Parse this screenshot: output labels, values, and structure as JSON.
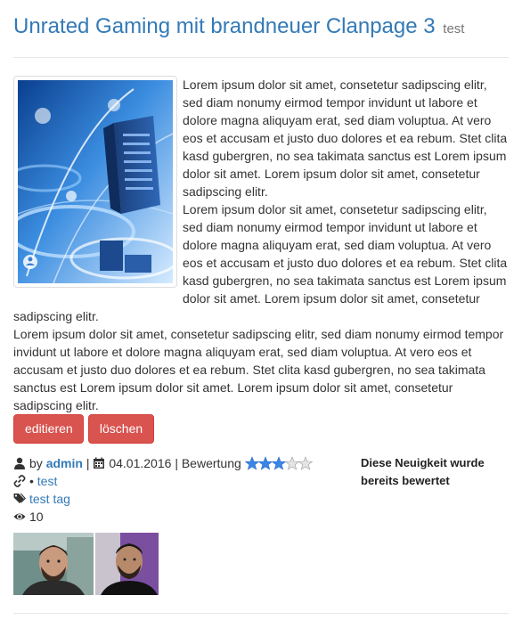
{
  "title": "Unrated Gaming mit brandneuer Clanpage 3",
  "title_tag": "test",
  "article": {
    "paragraph1": "Lorem ipsum dolor sit amet, consetetur sadipscing elitr, sed diam nonumy eirmod tempor invidunt ut labore et dolore magna aliquyam erat, sed diam voluptua. At vero eos et accusam et justo duo dolores et ea rebum. Stet clita kasd gubergren, no sea takimata sanctus est Lorem ipsum dolor sit amet. Lorem ipsum dolor sit amet, consetetur sadipscing elitr.",
    "paragraph2": "Lorem ipsum dolor sit amet, consetetur sadipscing elitr, sed diam nonumy eirmod tempor invidunt ut labore et dolore magna aliquyam erat, sed diam voluptua. At vero eos et accusam et justo duo dolores et ea rebum. Stet clita kasd gubergren, no sea takimata sanctus est Lorem ipsum dolor sit amet. Lorem ipsum dolor sit amet, consetetur sadipscing elitr.",
    "paragraph3": "Lorem ipsum dolor sit amet, consetetur sadipscing elitr, sed diam nonumy eirmod tempor invidunt ut labore et dolore magna aliquyam erat, sed diam voluptua. At vero eos et accusam et justo duo dolores et ea rebum. Stet clita kasd gubergren, no sea takimata sanctus est Lorem ipsum dolor sit amet. Lorem ipsum dolor sit amet, consetetur sadipscing elitr."
  },
  "buttons": {
    "edit_label": "editieren",
    "delete_label": "löschen"
  },
  "meta": {
    "by_label": "by",
    "author": "admin",
    "separator": "|",
    "date": "04.01.2016",
    "rating_label": "Bewertung",
    "rating_stars_filled": 3,
    "rating_stars_total": 5,
    "link_prefix": "•",
    "link_text": "test",
    "tag_text": "test tag",
    "views": "10",
    "rated_notice": "Diese Neuigkeit wurde bereits bewertet"
  },
  "colors": {
    "link": "#337ab7",
    "button": "#d9534f",
    "star_filled": "#3a86e8",
    "star_empty": "#d8d8d8"
  },
  "icons": [
    "user-icon",
    "calendar-icon",
    "link-icon",
    "tags-icon",
    "eye-icon",
    "star-icon"
  ]
}
